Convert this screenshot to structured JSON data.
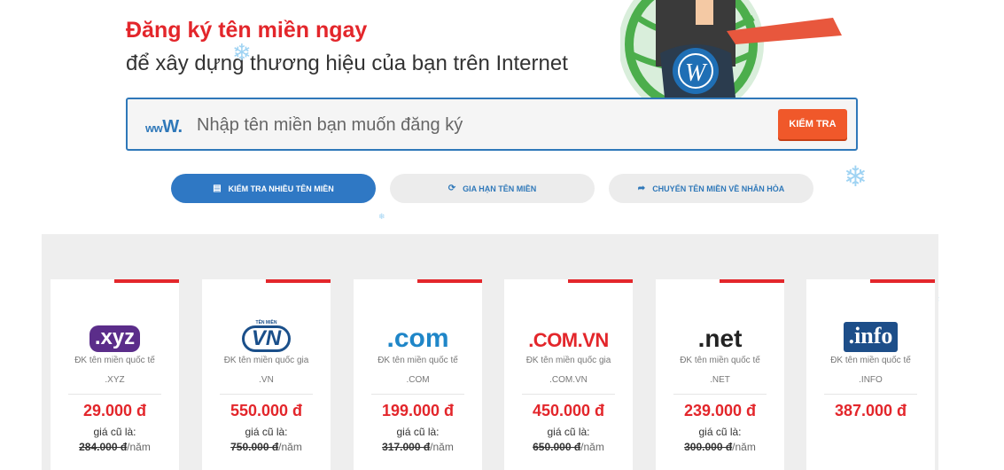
{
  "header": {
    "title": "Đăng ký tên miền ngay",
    "subtitle": "để xây dựng thương hiệu của bạn trên Internet"
  },
  "search": {
    "prefix_small": "ww",
    "prefix_big": "W.",
    "placeholder": "Nhập tên miền bạn muốn đăng ký",
    "button_label": "KIỂM TRA"
  },
  "actions": [
    {
      "label": "KIỂM TRA NHIỀU TÊN MIỀN",
      "icon": "list-icon"
    },
    {
      "label": "GIA HẠN TÊN MIỀN",
      "icon": "refresh-icon"
    },
    {
      "label": "CHUYỂN TÊN MIỀN VỀ NHÂN HÒA",
      "icon": "share-arrow-icon"
    }
  ],
  "domains": [
    {
      "logo_text": ".xyz",
      "desc": "ĐK tên miền quốc tế",
      "tld": ".XYZ",
      "price": "29.000 đ",
      "old_label": "giá cũ là:",
      "old_price": "284.000 đ",
      "unit": "/năm"
    },
    {
      "logo_text": "VN",
      "logo_small": "TÊN MIỀN",
      "desc": "ĐK tên miền quốc gia",
      "tld": ".VN",
      "price": "550.000 đ",
      "old_label": "giá cũ là:",
      "old_price": "750.000 đ",
      "unit": "/năm"
    },
    {
      "logo_text": ".com",
      "desc": "ĐK tên miền quốc tế",
      "tld": ".COM",
      "price": "199.000 đ",
      "old_label": "giá cũ là:",
      "old_price": "317.000 đ",
      "unit": "/năm"
    },
    {
      "logo_text": ".COM.VN",
      "desc": "ĐK tên miền quốc gia",
      "tld": ".COM.VN",
      "price": "450.000 đ",
      "old_label": "giá cũ là:",
      "old_price": "650.000 đ",
      "unit": "/năm"
    },
    {
      "logo_text": ".net",
      "desc": "ĐK tên miền quốc tế",
      "tld": ".NET",
      "price": "239.000 đ",
      "old_label": "giá cũ là:",
      "old_price": "300.000 đ",
      "unit": "/năm"
    },
    {
      "logo_text": ".info",
      "desc": "ĐK tên miền quốc tế",
      "tld": ".INFO",
      "price": "387.000 đ"
    }
  ],
  "colors": {
    "accent_red": "#e3262b",
    "brand_blue": "#2f78b9",
    "button_orange": "#f0582a"
  }
}
